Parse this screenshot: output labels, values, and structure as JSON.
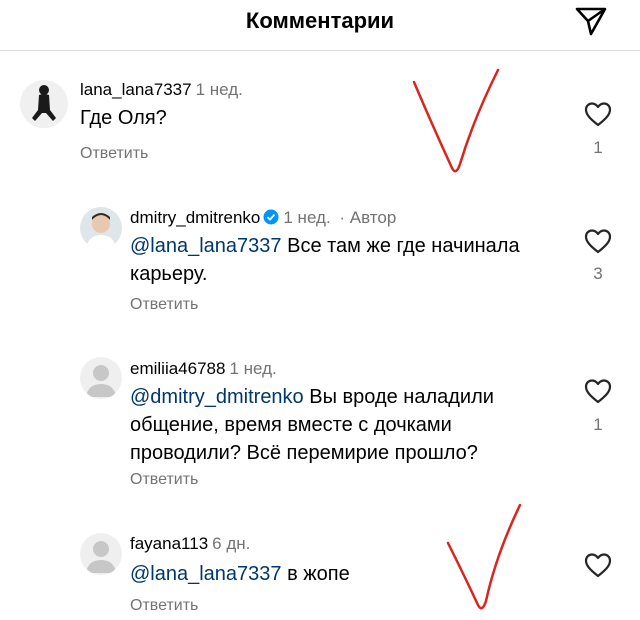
{
  "header": {
    "title": "Комментарии"
  },
  "colors": {
    "mention": "#00376b",
    "meta": "#737373",
    "verified": "#0095f6",
    "annotation": "#d9251d"
  },
  "comments": [
    {
      "username": "lana_lana7337",
      "time": "1 нед.",
      "author_tag": "",
      "mention": "",
      "text": "Где Оля?",
      "reply": "Ответить",
      "likes": "1"
    },
    {
      "username": "dmitry_dmitrenko",
      "time": "1 нед.",
      "author_tag": "· Автор",
      "mention": "@lana_lana7337",
      "text": " Все там же где начинала карьеру.",
      "reply": "Ответить",
      "likes": "3"
    },
    {
      "username": "emiliia46788",
      "time": "1 нед.",
      "author_tag": "",
      "mention": "@dmitry_dmitrenko",
      "text": " Вы вроде наладили общение, время вместе с дочками проводили? Всё перемирие прошло?",
      "reply": "Ответить",
      "likes": "1"
    },
    {
      "username": "fayana113",
      "time": "6 дн.",
      "author_tag": "",
      "mention": "@lana_lana7337",
      "text": " в жопе",
      "reply": "Ответить",
      "likes": ""
    }
  ],
  "icons": {
    "send": "send-icon",
    "like": "heart-outline-icon",
    "verified": "verified-badge-icon"
  }
}
